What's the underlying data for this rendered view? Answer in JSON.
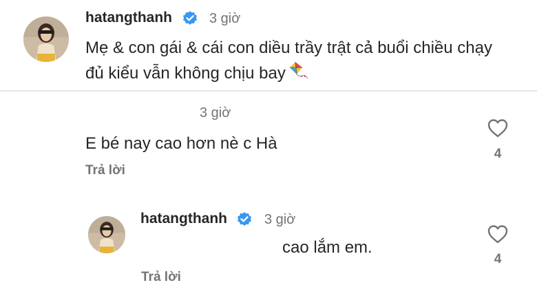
{
  "caption": {
    "username": "hatangthanh",
    "time": "3 giờ",
    "text": "Mẹ & con gái & cái con diều trầy trật cả buổi chiều chạy đủ kiểu vẫn không chịu bay",
    "emoji_icon": "kite-icon"
  },
  "comments": [
    {
      "time": "3 giờ",
      "text": "E bé nay cao hơn nè c Hà",
      "reply_label": "Trả lời",
      "likes": "4"
    },
    {
      "username": "hatangthanh",
      "time": "3 giờ",
      "text": "cao lắm em.",
      "reply_label": "Trả lời",
      "likes": "4"
    }
  ],
  "colors": {
    "verified": "#3897f0",
    "secondary_text": "#737373",
    "primary_text": "#262626",
    "divider": "#e6e6e6"
  }
}
